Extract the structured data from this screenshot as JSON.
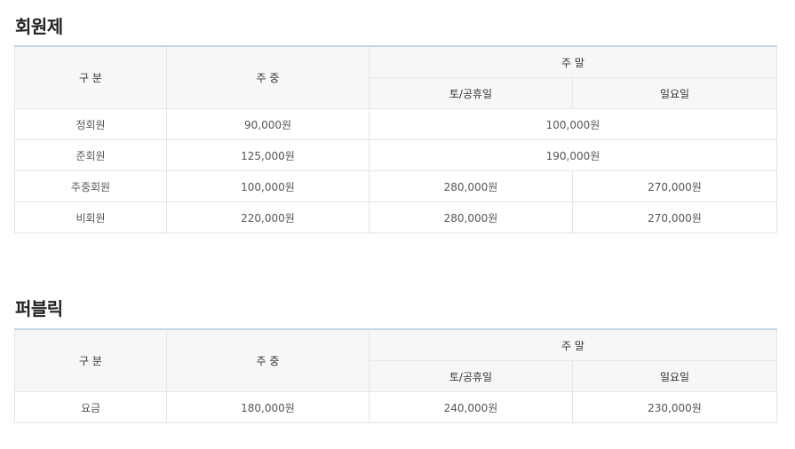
{
  "headers": {
    "category": "구 분",
    "weekday": "주 중",
    "weekend": "주 말",
    "sat_holiday": "토/공휴일",
    "sunday": "일요일"
  },
  "membership": {
    "title": "회원제",
    "rows": [
      {
        "category": "정회원",
        "weekday": "90,000원",
        "weekend": "100,000원"
      },
      {
        "category": "준회원",
        "weekday": "125,000원",
        "weekend": "190,000원"
      },
      {
        "category": "주중회원",
        "weekday": "100,000원",
        "sat_holiday": "280,000원",
        "sunday": "270,000원"
      },
      {
        "category": "비회원",
        "weekday": "220,000원",
        "sat_holiday": "280,000원",
        "sunday": "270,000원"
      }
    ]
  },
  "public": {
    "title": "퍼블릭",
    "rows": [
      {
        "category": "요금",
        "weekday": "180,000원",
        "sat_holiday": "240,000원",
        "sunday": "230,000원"
      }
    ]
  }
}
